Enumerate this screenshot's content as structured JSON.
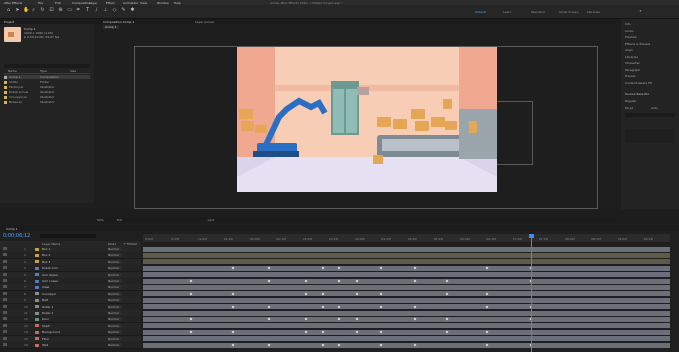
{
  "menu": [
    "After Effects",
    "File",
    "Edit",
    "Composition",
    "Layer",
    "Effect",
    "Animation",
    "View",
    "Window",
    "Help"
  ],
  "window_title": "Adobe After Effects 2020 - Untitled Project.aep *",
  "workspaces": [
    "Default",
    "Learn",
    "Standard",
    "Small Screen",
    "Libraries"
  ],
  "workspace_active": 0,
  "project": {
    "tab": "Project",
    "preview_name": "Comp 1",
    "preview_info": [
      "1920 x 1080 (1.00)",
      "Δ 0;00;10;00, 29.97 fps"
    ],
    "items": [
      {
        "name": "Comp 1",
        "color": "#a6a6a6",
        "type": "Composition"
      },
      {
        "name": "Solids",
        "color": "#d6b451",
        "type": "Folder"
      },
      {
        "name": "Factory.ai",
        "color": "#d6b451",
        "type": "Illustrator"
      },
      {
        "name": "Robot arm.ai",
        "color": "#d6b451",
        "type": "Illustrator"
      },
      {
        "name": "Conveyor.ai",
        "color": "#d6b451",
        "type": "Illustrator"
      },
      {
        "name": "Boxes.ai",
        "color": "#d6b451",
        "type": "Illustrator"
      }
    ],
    "col_headers": [
      "Name",
      "Type",
      "Size"
    ]
  },
  "composition": {
    "tab": "Composition Comp 1",
    "subtab": "Comp 1",
    "footer": [
      "50%",
      "Full",
      "+0.0"
    ]
  },
  "right_panel": {
    "tabs": [
      "Info",
      "Audio",
      "Preview",
      "Effects & Presets",
      "Align",
      "Libraries",
      "Character",
      "Paragraph",
      "Tracker",
      "Content-Aware Fill"
    ],
    "font": "Source Sans Pro",
    "style": "Regular",
    "size": "60 px",
    "leading": "Auto"
  },
  "timeline": {
    "tab": "Comp 1",
    "timecode": "0;00;06;12",
    "columns": [
      "Layer Name",
      "Mode",
      "T TrkMat",
      "Parent & Link"
    ],
    "ticks": [
      "0;00f",
      "0;15f",
      "01;00f",
      "01;15f",
      "02;00f",
      "02;15f",
      "03;00f",
      "03;15f",
      "04;00f",
      "04;15f",
      "05;00f",
      "05;15f",
      "06;00f",
      "06;15f",
      "07;00f",
      "07;15f",
      "08;00f",
      "08;15f",
      "09;00f",
      "09;15f"
    ],
    "layers": [
      {
        "num": "1",
        "name": "Box 1",
        "color": "#c7a14e",
        "mode": "Normal"
      },
      {
        "num": "2",
        "name": "Box 2",
        "color": "#c7a14e",
        "mode": "Normal"
      },
      {
        "num": "3",
        "name": "Box 3",
        "color": "#c7a14e",
        "mode": "Normal"
      },
      {
        "num": "4",
        "name": "Robot Arm",
        "color": "#4f7fbf",
        "mode": "Normal"
      },
      {
        "num": "5",
        "name": "Arm Upper",
        "color": "#4f7fbf",
        "mode": "Normal"
      },
      {
        "num": "6",
        "name": "Arm Lower",
        "color": "#4f7fbf",
        "mode": "Normal"
      },
      {
        "num": "7",
        "name": "Claw",
        "color": "#4f7fbf",
        "mode": "Normal"
      },
      {
        "num": "8",
        "name": "Conveyor",
        "color": "#8a8a8a",
        "mode": "Normal"
      },
      {
        "num": "9",
        "name": "Belt",
        "color": "#8a8a8a",
        "mode": "Normal"
      },
      {
        "num": "10",
        "name": "Roller 1",
        "color": "#8a8a8a",
        "mode": "Normal"
      },
      {
        "num": "11",
        "name": "Roller 2",
        "color": "#8a8a8a",
        "mode": "Normal"
      },
      {
        "num": "12",
        "name": "Door",
        "color": "#5a9a7a",
        "mode": "Normal"
      },
      {
        "num": "13",
        "name": "Shelf",
        "color": "#c06f5c",
        "mode": "Normal"
      },
      {
        "num": "14",
        "name": "Background",
        "color": "#c06f5c",
        "mode": "Normal"
      },
      {
        "num": "15",
        "name": "Floor",
        "color": "#c06f5c",
        "mode": "Normal"
      },
      {
        "num": "16",
        "name": "Wall",
        "color": "#c06f5c",
        "mode": "Normal"
      }
    ]
  }
}
